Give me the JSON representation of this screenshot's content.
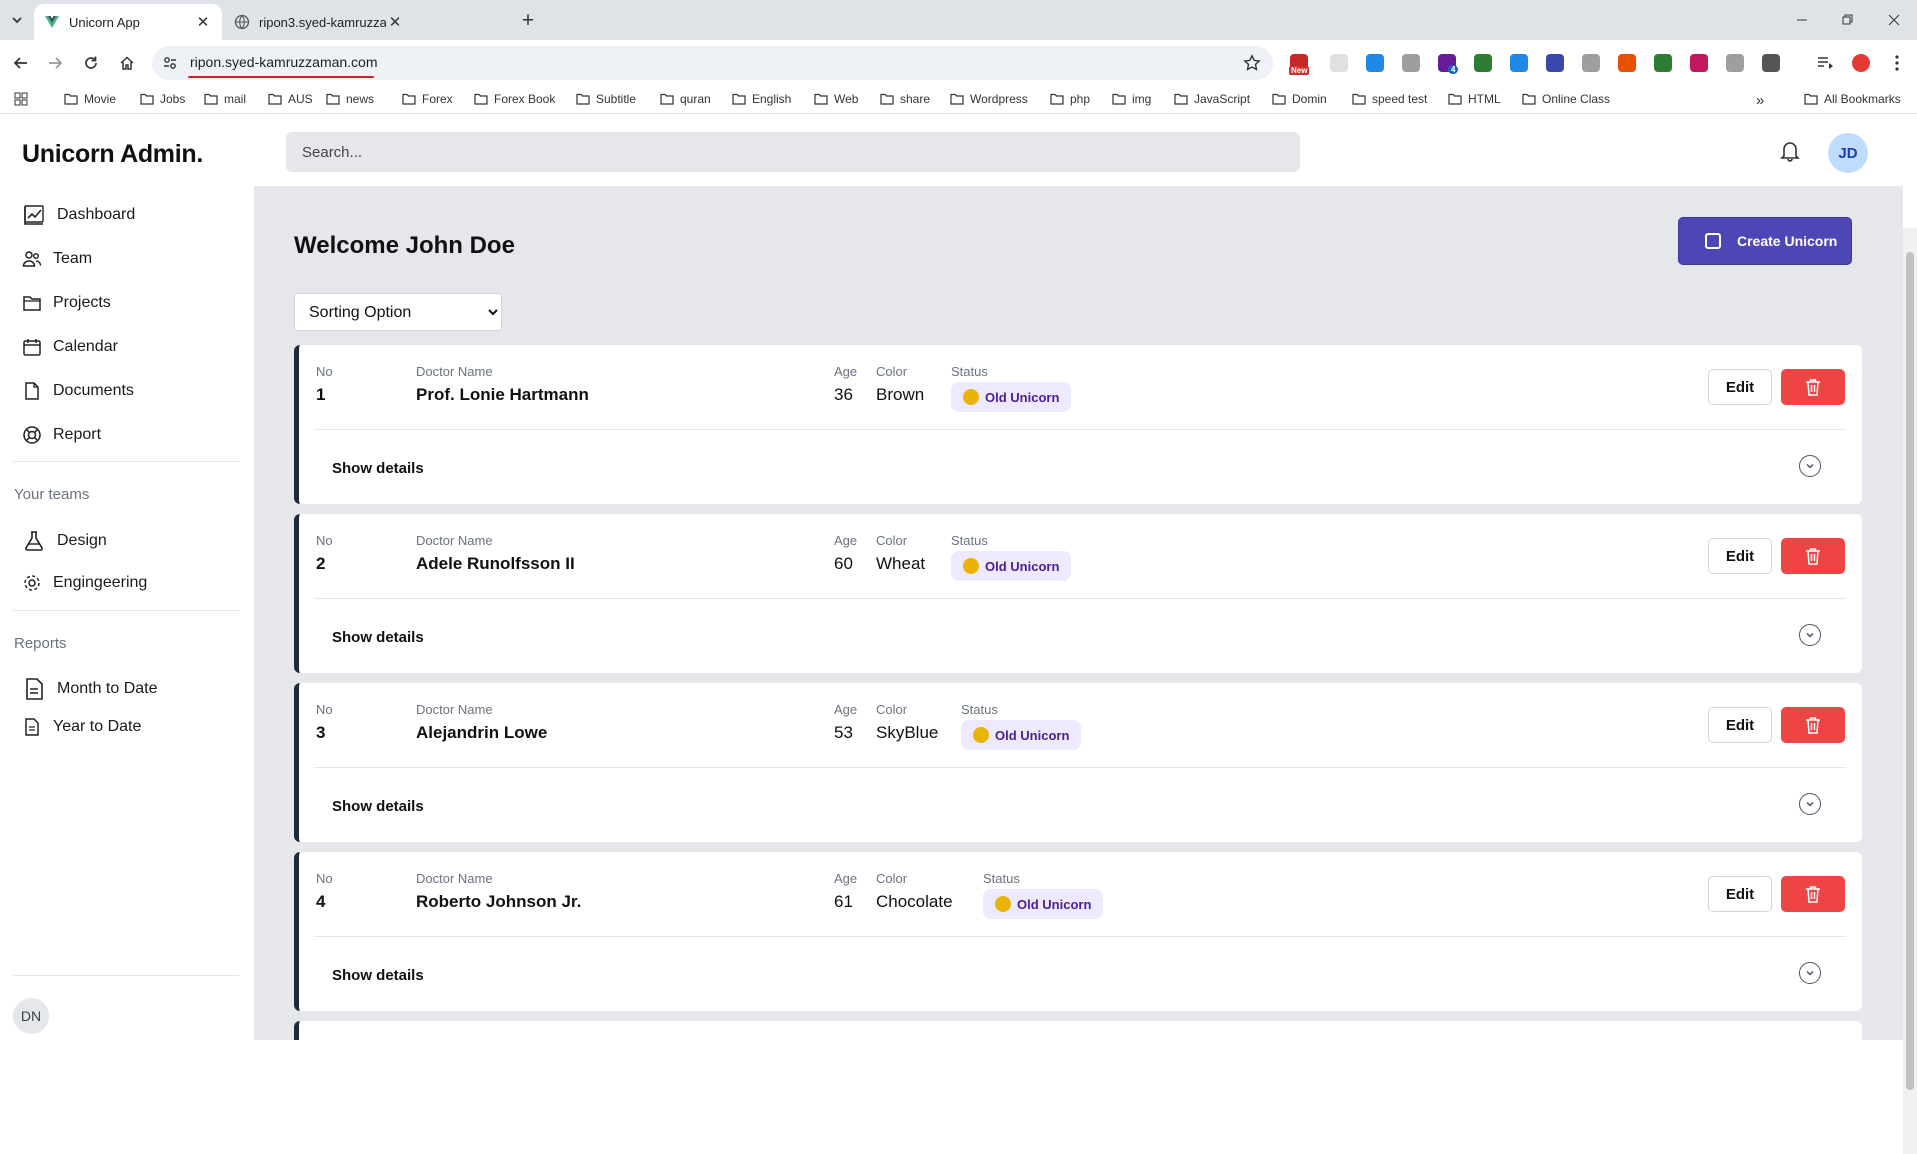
{
  "browser": {
    "tabs": [
      {
        "title": "Unicorn App",
        "active": true,
        "icon": "vue-logo-icon"
      },
      {
        "title": "ripon3.syed-kamruzzaman.com",
        "active": false,
        "icon": "globe-icon"
      }
    ],
    "url": "ripon.syed-kamruzzaman.com",
    "extensions": [
      "new-badge-ext-icon",
      "page-ext-icon",
      "translate-ext-icon",
      "cloud-ext-icon",
      "purple-ext-icon",
      "vue-ext-icon",
      "doc-ext-icon",
      "circle-ext-icon",
      "clock-ext-icon",
      "fox-ext-icon",
      "grammarly-ext-icon",
      "link-ext-icon",
      "barcode-ext-icon",
      "puzzle-ext-icon"
    ],
    "extension_badges": {
      "new": "New",
      "count": "4"
    },
    "bookmarks": [
      "Movie",
      "Jobs",
      "mail",
      "AUS",
      "news",
      "Forex",
      "Forex Book",
      "Subtitle",
      "quran",
      "English",
      "Web",
      "share",
      "Wordpress",
      "php",
      "img",
      "JavaScript",
      "Domin",
      "speed test",
      "HTML",
      "Online Class"
    ],
    "all_bookmarks": "All Bookmarks",
    "more_bookmarks": "»"
  },
  "sidebar": {
    "brand": "Unicorn Admin.",
    "nav": [
      {
        "label": "Dashboard",
        "icon": "chart-icon"
      },
      {
        "label": "Team",
        "icon": "users-icon"
      },
      {
        "label": "Projects",
        "icon": "folder-icon"
      },
      {
        "label": "Calendar",
        "icon": "calendar-icon"
      },
      {
        "label": "Documents",
        "icon": "document-icon"
      },
      {
        "label": "Report",
        "icon": "support-icon"
      }
    ],
    "teams_heading": "Your teams",
    "teams": [
      {
        "label": "Design",
        "icon": "beaker-icon"
      },
      {
        "label": "Engingeering",
        "icon": "cog-icon"
      }
    ],
    "reports_heading": "Reports",
    "reports": [
      {
        "label": "Month to Date",
        "icon": "document-text-icon"
      },
      {
        "label": "Year to Date",
        "icon": "document-text-icon"
      }
    ],
    "user_initials": "DN"
  },
  "header": {
    "search_placeholder": "Search...",
    "avatar_initials": "JD"
  },
  "main": {
    "welcome": "Welcome John Doe",
    "create_label": "Create Unicorn",
    "sort_selected": "Sorting Option",
    "columns": {
      "no": "No",
      "name": "Doctor Name",
      "age": "Age",
      "color": "Color",
      "status": "Status"
    },
    "edit_label": "Edit",
    "details_label": "Show details",
    "rows": [
      {
        "no": "1",
        "name": "Prof. Lonie Hartmann",
        "age": "36",
        "color": "Brown",
        "status": "Old Unicorn"
      },
      {
        "no": "2",
        "name": "Adele Runolfsson II",
        "age": "60",
        "color": "Wheat",
        "status": "Old Unicorn"
      },
      {
        "no": "3",
        "name": "Alejandrin Lowe",
        "age": "53",
        "color": "SkyBlue",
        "status": "Old Unicorn"
      },
      {
        "no": "4",
        "name": "Roberto Johnson Jr.",
        "age": "61",
        "color": "Chocolate",
        "status": "Old Unicorn"
      }
    ]
  },
  "colors": {
    "primary": "#4f46b5",
    "danger": "#ef4444",
    "badge_bg": "#ede9fe",
    "main_bg": "#e5e7eb",
    "card_accent": "#1f2937"
  }
}
